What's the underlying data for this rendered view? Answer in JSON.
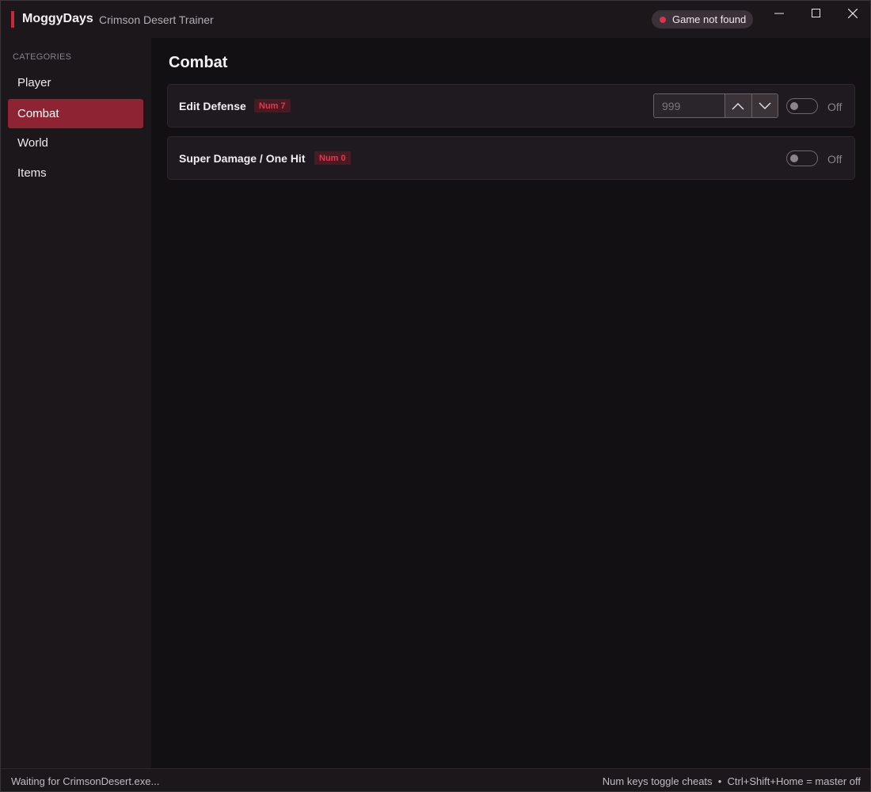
{
  "titlebar": {
    "brand_name": "MoggyDays",
    "app_subtitle": "Crimson Desert Trainer",
    "status_text": "Game not found",
    "status_color": "#e0314a",
    "accent_color": "#c8283d",
    "window_controls": [
      "minimize-icon",
      "maximize-icon",
      "close-icon"
    ]
  },
  "sidebar": {
    "section_label": "CATEGORIES",
    "items": [
      {
        "label": "Player",
        "active": false
      },
      {
        "label": "Combat",
        "active": true
      },
      {
        "label": "World",
        "active": false
      },
      {
        "label": "Items",
        "active": false
      }
    ]
  },
  "main": {
    "title": "Combat",
    "cheats": [
      {
        "name": "Edit Defense",
        "hotkey": "Num 7",
        "value_placeholder": "999",
        "toggle_state": "Off",
        "icons": [
          "chevron-up-icon",
          "chevron-down-icon"
        ]
      },
      {
        "name": "Super Damage / One Hit",
        "hotkey": "Num 0",
        "toggle_state": "Off"
      }
    ]
  },
  "footer": {
    "left_text": "Waiting for CrimsonDesert.exe...",
    "right_text": "Num keys toggle cheats  •  Ctrl+Shift+Home = master off"
  }
}
